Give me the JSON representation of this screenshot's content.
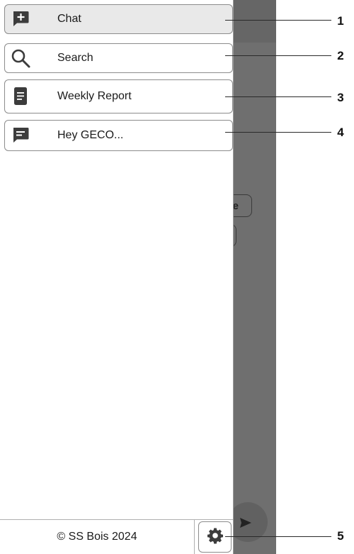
{
  "background_app": {
    "chip_text": "e"
  },
  "drawer": {
    "items": [
      {
        "label": "Chat",
        "icon": "add-chat-icon",
        "active": true
      },
      {
        "label": "Search",
        "icon": "search-icon",
        "active": false
      },
      {
        "label": "Weekly Report",
        "icon": "document-icon",
        "active": false
      },
      {
        "label": "Hey GECO...",
        "icon": "chat-bubble-icon",
        "active": false
      }
    ],
    "footer": {
      "copyright": "© SS Bois 2024",
      "settings_icon": "gear-icon"
    }
  },
  "annotations": [
    "1",
    "2",
    "3",
    "4",
    "5"
  ],
  "colors": {
    "overlay": "#6f6f6f",
    "icon": "#3c3c3c",
    "border": "#8c8c8c"
  }
}
